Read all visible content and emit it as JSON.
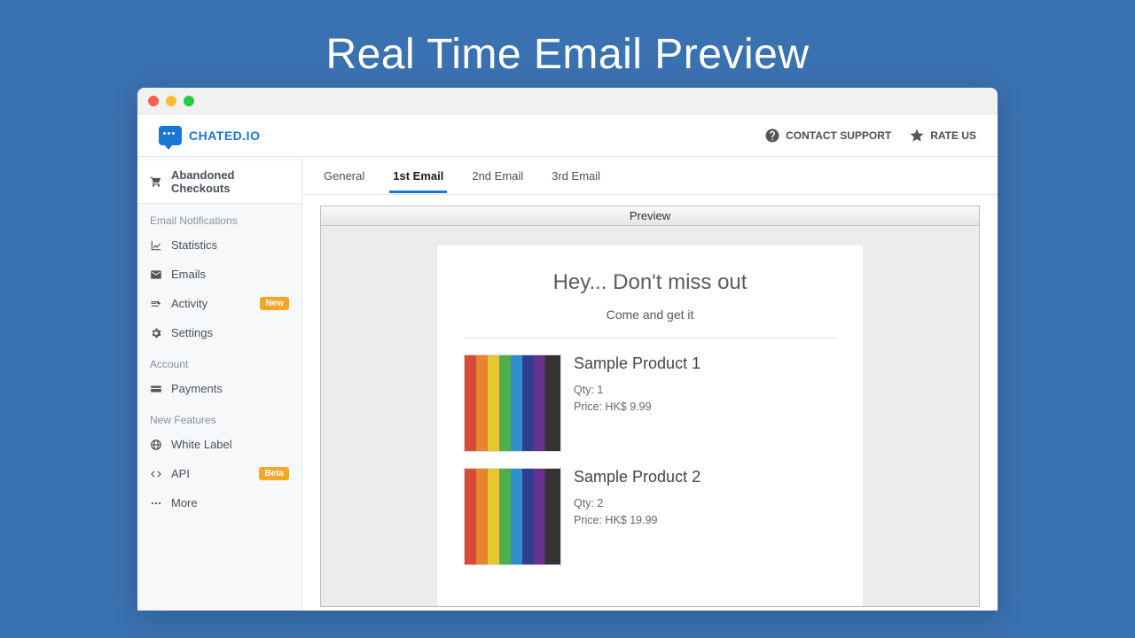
{
  "hero": {
    "title": "Real Time Email Preview"
  },
  "brand": {
    "name": "CHATED.IO"
  },
  "topbar": {
    "contact_support": "CONTACT SUPPORT",
    "rate_us": "RATE US"
  },
  "sidebar": {
    "primary": "Abandoned Checkouts",
    "section_email": "Email Notifications",
    "items_email": {
      "statistics": "Statistics",
      "emails": "Emails",
      "activity": "Activity",
      "activity_badge": "New",
      "settings": "Settings"
    },
    "section_account": "Account",
    "items_account": {
      "payments": "Payments"
    },
    "section_new": "New Features",
    "items_new": {
      "white_label": "White Label",
      "api": "API",
      "api_badge": "Beta",
      "more": "More"
    }
  },
  "tabs": {
    "general": "General",
    "first": "1st Email",
    "second": "2nd Email",
    "third": "3rd Email"
  },
  "preview": {
    "header": "Preview",
    "heading": "Hey... Don't miss out",
    "subheading": "Come and get it",
    "products": [
      {
        "name": "Sample Product 1",
        "qty_label": "Qty: 1",
        "price_label": "Price: HK$ 9.99"
      },
      {
        "name": "Sample Product 2",
        "qty_label": "Qty: 2",
        "price_label": "Price: HK$ 19.99"
      }
    ]
  }
}
